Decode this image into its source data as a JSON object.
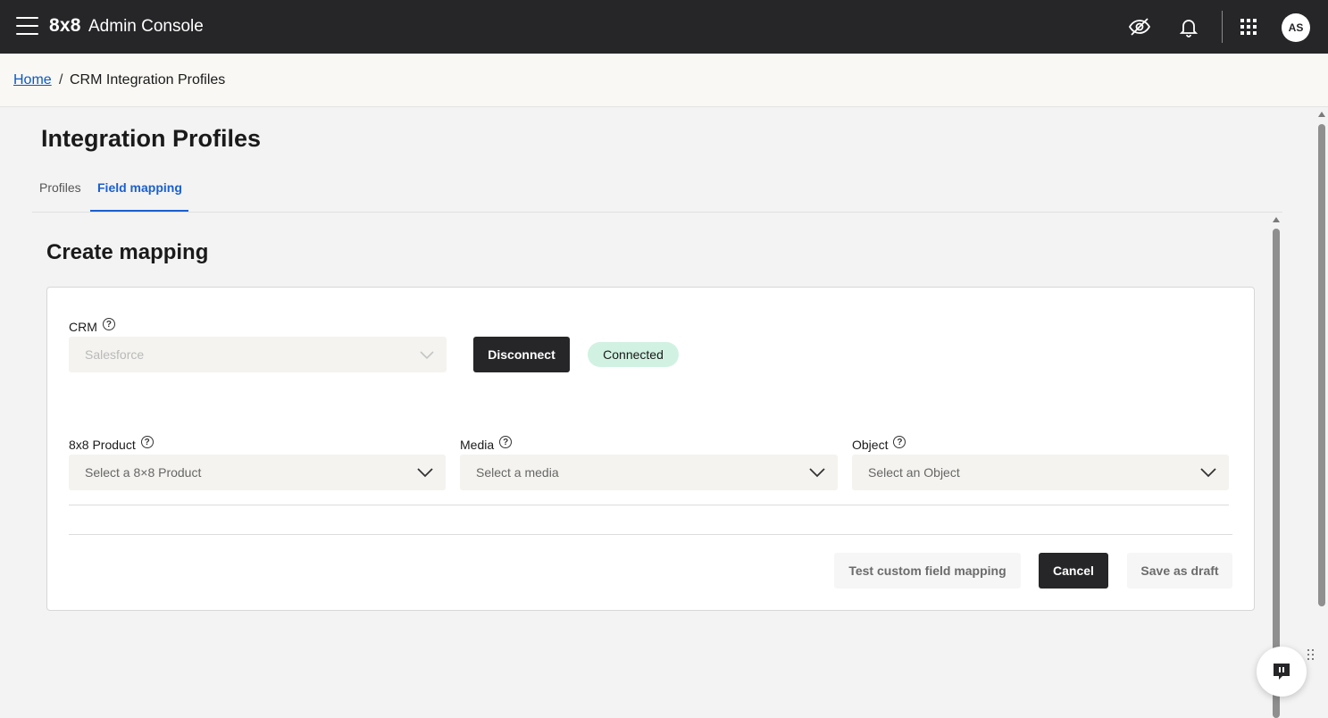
{
  "header": {
    "logo": "8x8",
    "title": "Admin Console",
    "avatar_initials": "AS",
    "icons": [
      "menu-icon",
      "eye-off-icon",
      "bell-icon",
      "apps-grid-icon"
    ]
  },
  "breadcrumb": {
    "home": "Home",
    "separator": "/",
    "current": "CRM Integration Profiles"
  },
  "page": {
    "title": "Integration Profiles",
    "tabs": [
      {
        "label": "Profiles",
        "active": false
      },
      {
        "label": "Field mapping",
        "active": true
      }
    ]
  },
  "mapping": {
    "title": "Create mapping",
    "crm": {
      "label": "CRM",
      "value": "Salesforce",
      "disconnect_label": "Disconnect",
      "status": "Connected"
    },
    "fields": {
      "product": {
        "label": "8x8 Product",
        "placeholder": "Select a 8×8 Product"
      },
      "media": {
        "label": "Media",
        "placeholder": "Select a media"
      },
      "object": {
        "label": "Object",
        "placeholder": "Select an Object"
      }
    },
    "actions": {
      "test": "Test custom field mapping",
      "cancel": "Cancel",
      "save_draft": "Save as draft"
    }
  },
  "colors": {
    "topbar": "#262629",
    "accent": "#1a5fd0",
    "connected_badge": "#d1f2e2"
  }
}
